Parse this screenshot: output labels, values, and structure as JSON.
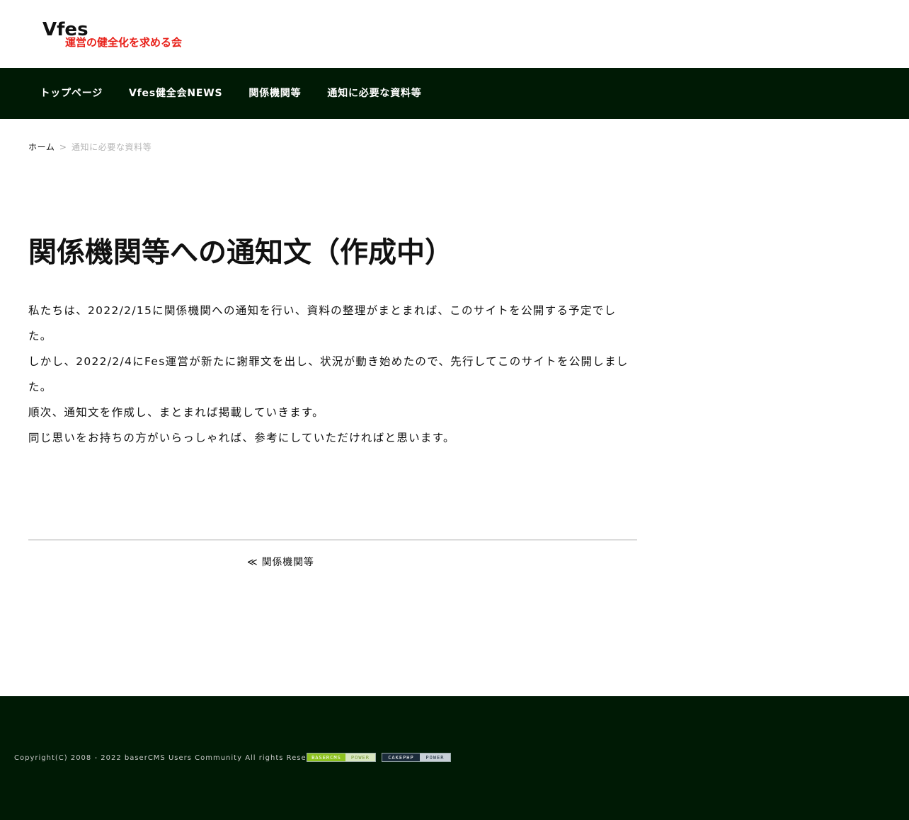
{
  "header": {
    "logo": {
      "main_text": "Vfes",
      "sub_text": "運営の健全化を求める会"
    }
  },
  "nav": {
    "items": [
      {
        "label": "トップページ"
      },
      {
        "label": "Vfes健全会NEWS"
      },
      {
        "label": "関係機関等"
      },
      {
        "label": "通知に必要な資料等"
      }
    ]
  },
  "breadcrumb": {
    "home": "ホーム",
    "separator": ">",
    "current": "通知に必要な資料等"
  },
  "article": {
    "title": "関係機関等への通知文（作成中）",
    "paragraphs": [
      "私たちは、2022/2/15に関係機関への通知を行い、資料の整理がまとまれば、このサイトを公開する予定でした。",
      "しかし、2022/2/4にFes運営が新たに謝罪文を出し、状況が動き始めたので、先行してこのサイトを公開しました。",
      "順次、通知文を作成し、まとまれば掲載していきます。",
      "同じ思いをお持ちの方がいらっしゃれば、参考にしていただければと思います。"
    ]
  },
  "pager": {
    "prev_label": "≪ 関係機関等"
  },
  "footer": {
    "copyright": "Copyright(C) 2008 - 2022 baserCMS Users Community All rights Reserved.",
    "badges": [
      {
        "left": "BASERCMS",
        "right": "POWER"
      },
      {
        "left": "CAKEPHP",
        "right": "POWER"
      }
    ]
  },
  "colors": {
    "nav_bg": "#001a05",
    "footer_bg": "#001a05",
    "logo_red": "#e8211a",
    "logo_black": "#111111"
  }
}
